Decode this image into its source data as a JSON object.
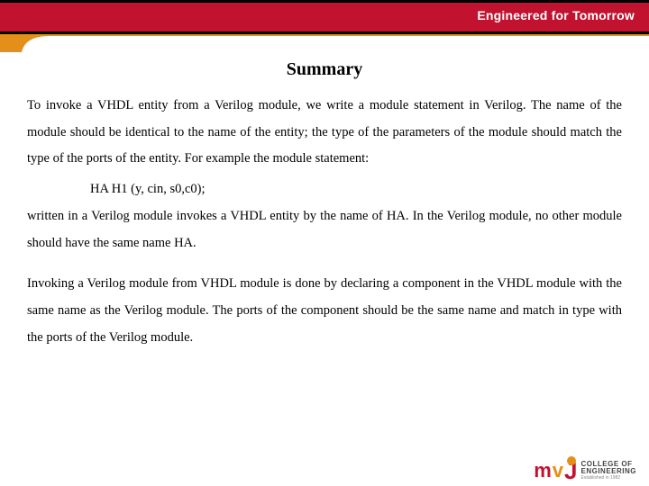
{
  "header": {
    "tagline": "Engineered for Tomorrow"
  },
  "title": "Summary",
  "body": {
    "p1": "To invoke a VHDL entity from a Verilog module, we write a module statement in Verilog.  The name of the module should be identical to the name of the entity; the type of the parameters of the module should match the type of the ports of the entity. For example the module statement:",
    "code": "HA   H1 (y, cin, s0,c0);",
    "p2": " written in a Verilog module invokes a VHDL entity by the name of HA. In the Verilog module, no other module should have the same name HA.",
    "p3": "Invoking a Verilog module from VHDL module is done by declaring a component in the VHDL module with the same name as the Verilog module. The ports of the component should be the same name and match in type with the ports of the Verilog module."
  },
  "logo": {
    "line1": "COLLEGE OF",
    "line2": "ENGINEERING",
    "line3": "Established in 1982"
  }
}
